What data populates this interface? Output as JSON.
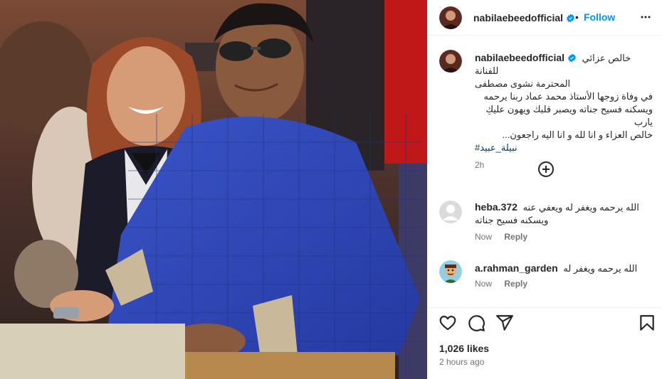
{
  "post": {
    "username": "nabilaebeedofficial",
    "dot": "•",
    "follow_label": "Follow",
    "more_icon": "more-horizontal-icon",
    "caption": {
      "username": "nabilaebeedofficial",
      "line1": "خالص عزائي للفنانة",
      "line2": "المحترمة نشوى مصطفى",
      "line3": "في وفاة زوجها الأستاذ محمد عماد ربنا يرحمه",
      "line4": "ويسكنه فسيح جناته ويصبر قلبك ويهون عليكِ يارب",
      "line5": "خالص العزاء و انا لله و انا اليه راجعون...",
      "hashtag": "#نبيلة_عبيد",
      "time": "2h"
    },
    "comments": [
      {
        "username": "heba.372",
        "text": "الله يرحمه ويغفر له ويعفي عنه ويسكنه فسيح جناته",
        "time": "Now",
        "reply": "Reply",
        "avatar": "default-avatar"
      },
      {
        "username": "a.rahman_garden",
        "text": "الله يرحمه ويغفر له",
        "time": "Now",
        "reply": "Reply",
        "avatar": "cartoon-avatar"
      }
    ],
    "likes": "1,026 likes",
    "posted": "2 hours ago"
  },
  "colors": {
    "accent": "#0095f6",
    "verified": "#0095f6",
    "text": "#262626",
    "muted": "#737373",
    "hashtag": "#00376b"
  },
  "icons": [
    "heart-icon",
    "comment-icon",
    "share-icon",
    "bookmark-icon",
    "add-circle-icon",
    "verified-badge-icon"
  ]
}
